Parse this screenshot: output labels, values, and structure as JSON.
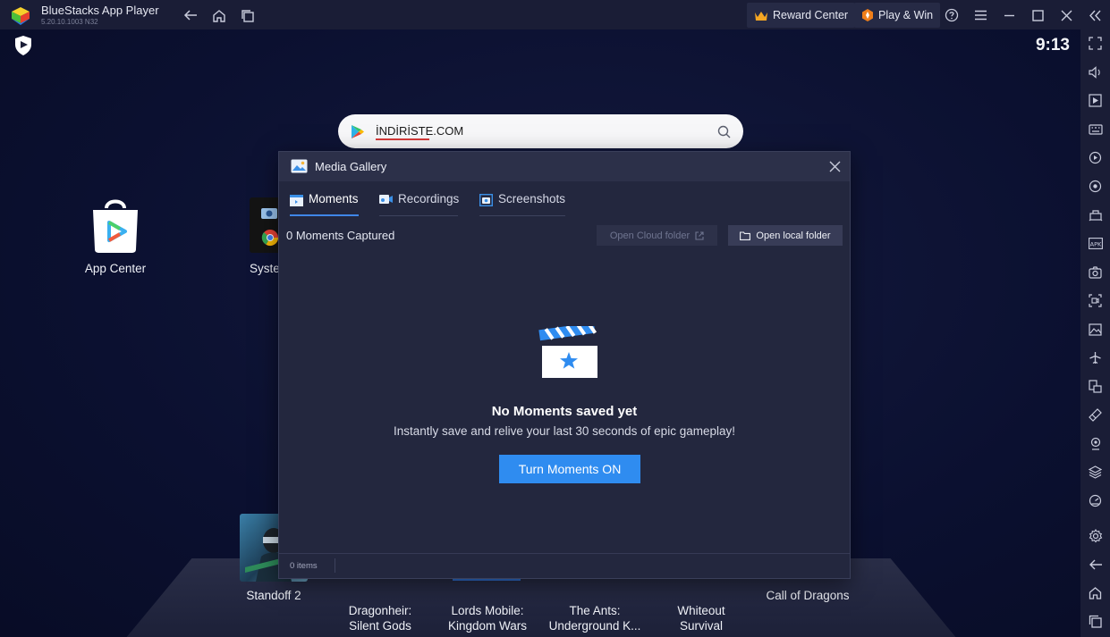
{
  "titlebar": {
    "app_name": "BlueStacks App Player",
    "version": "5.20.10.1003  N32",
    "reward_center": "Reward Center",
    "play_win": "Play & Win"
  },
  "screen": {
    "clock": "9:13",
    "search": {
      "text": "İNDİRİSTE.COM"
    },
    "desktop_apps": [
      {
        "label": "App Center"
      },
      {
        "label": "Syste"
      }
    ],
    "dock_apps": [
      {
        "label": "Standoff 2"
      },
      {
        "label": "Dragonheir:\nSilent Gods"
      },
      {
        "label": "Lords Mobile:\nKingdom Wars"
      },
      {
        "label": "The Ants:\nUnderground K..."
      },
      {
        "label": "Whiteout\nSurvival"
      },
      {
        "label": "Call of Dragons"
      }
    ]
  },
  "dialog": {
    "title": "Media Gallery",
    "tabs": [
      {
        "label": "Moments",
        "active": true
      },
      {
        "label": "Recordings",
        "active": false
      },
      {
        "label": "Screenshots",
        "active": false
      }
    ],
    "captured": "0 Moments Captured",
    "open_cloud": "Open Cloud folder",
    "open_local": "Open local folder",
    "empty_title": "No Moments saved yet",
    "empty_subtitle": "Instantly save and relive your last 30 seconds of epic gameplay!",
    "turn_on": "Turn Moments ON",
    "footer_items": "0 items"
  },
  "colors": {
    "accent": "#2f8cf0",
    "titlebar_bg": "#1a1d36",
    "dialog_bg": "#23273e"
  },
  "icons": {
    "titlebar": [
      "bluestacks-logo",
      "back-arrow-icon",
      "home-icon",
      "recent-apps-icon",
      "crown-icon",
      "play-win-icon",
      "help-icon",
      "menu-icon",
      "minimize-icon",
      "maximize-icon",
      "close-icon",
      "collapse-sidebar-icon"
    ],
    "sidebar": [
      "fullscreen-icon",
      "volume-icon",
      "media-import-icon",
      "keyboard-icon",
      "macro-icon",
      "sync-icon",
      "performance-icon",
      "apk-icon",
      "screenshot-icon",
      "screen-record-icon",
      "media-folder-icon",
      "airplane-mode-icon",
      "multi-instance-icon",
      "eco-mode-icon",
      "location-icon",
      "layers-icon",
      "speed-icon",
      "settings-icon",
      "back-icon",
      "home-icon",
      "recent-apps-icon"
    ]
  }
}
